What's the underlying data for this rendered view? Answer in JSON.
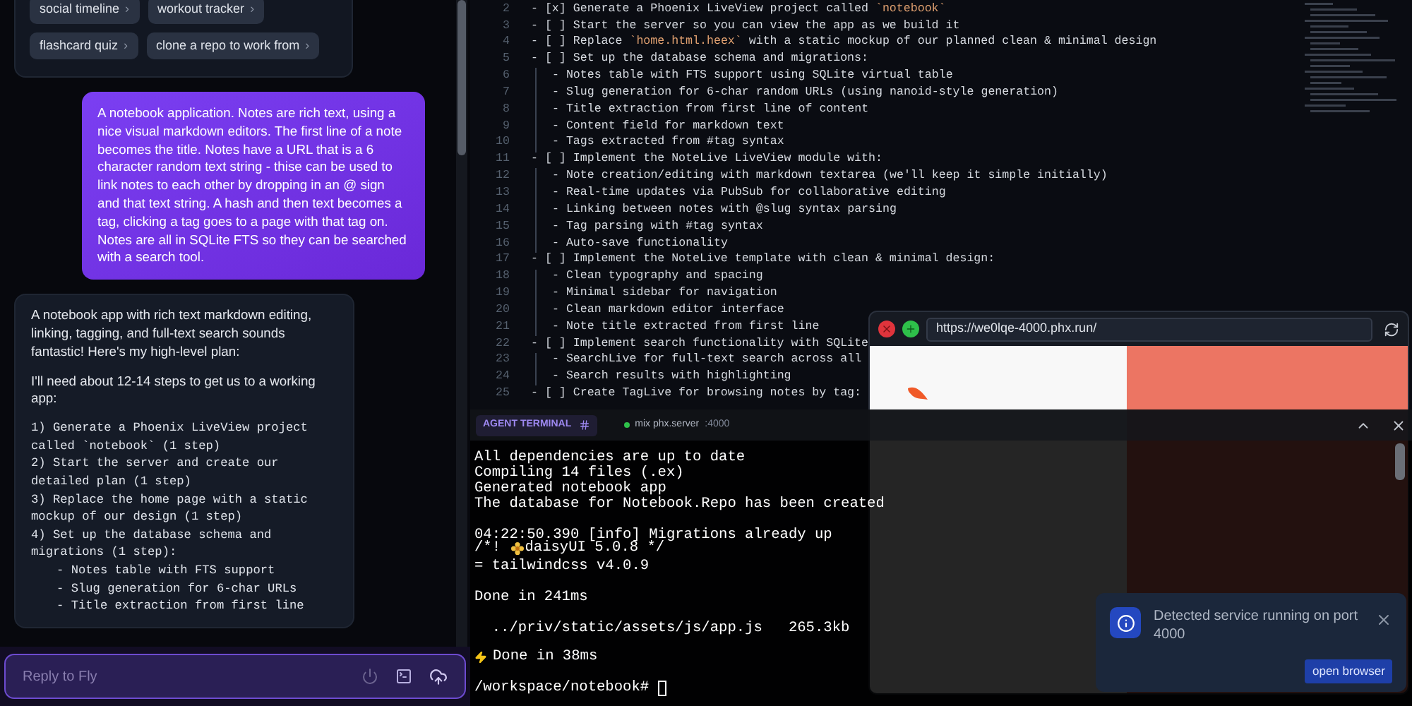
{
  "chat": {
    "suggestions": [
      {
        "label": "social timeline",
        "arrow": "›"
      },
      {
        "label": "workout tracker",
        "arrow": "›"
      },
      {
        "label": "flashcard quiz",
        "arrow": "›"
      },
      {
        "label": "clone a repo to work from",
        "arrow": "›"
      }
    ],
    "user_message": "A notebook application. Notes are rich text, using a nice visual markdown editors. The first line of a note becomes the title. Notes have a URL that is a 6 character random text string - thise can be used to link notes to each other by dropping in an @ sign and that text string. A hash and then text becomes a tag, clicking a tag goes to a page with that tag on. Notes are all in SQLite FTS so they can be searched with a search tool.",
    "assistant_message": {
      "paragraphs": [
        "A notebook app with rich text markdown editing, linking, tagging, and full-text search sounds fantastic! Here's my high-level plan:",
        "I'll need about 12-14 steps to get us to a working app:"
      ],
      "plan": [
        {
          "text": "1) Generate a Phoenix LiveView project called `notebook` (1 step)"
        },
        {
          "text": "2) Start the server and create our detailed plan (1 step)"
        },
        {
          "text": "3) Replace the home page with a static mockup of our design (1 step)"
        },
        {
          "text": "4) Set up the database schema and migrations (1 step):",
          "children": [
            {
              "text": "- Notes table with FTS support"
            },
            {
              "text": "- Slug generation for 6-char URLs"
            },
            {
              "text": "- Title extraction from first line"
            }
          ]
        }
      ]
    },
    "input": {
      "placeholder": "Reply to Fly"
    }
  },
  "editor": {
    "lines": [
      {
        "number": "2",
        "parts": [
          {
            "kind": "plain",
            "text": "- [x] Generate a Phoenix LiveView project called "
          },
          {
            "kind": "code",
            "text": "`notebook`"
          }
        ]
      },
      {
        "number": "3",
        "parts": [
          {
            "kind": "plain",
            "text": "- [ ] Start the server so you can view the app as we build it"
          }
        ]
      },
      {
        "number": "4",
        "parts": [
          {
            "kind": "plain",
            "text": "- [ ] Replace "
          },
          {
            "kind": "code",
            "text": "`home.html.heex`"
          },
          {
            "kind": "plain",
            "text": " with a static mockup of our planned clean & minimal design"
          }
        ]
      },
      {
        "number": "5",
        "parts": [
          {
            "kind": "plain",
            "text": "- [ ] Set up the database schema and migrations:"
          }
        ],
        "children": [
          {
            "number": "6",
            "parts": [
              {
                "kind": "plain",
                "text": "- Notes table with FTS support using SQLite virtual table"
              }
            ]
          },
          {
            "number": "7",
            "parts": [
              {
                "kind": "plain",
                "text": "- Slug generation for 6-char random URLs (using nanoid-style generation)"
              }
            ]
          },
          {
            "number": "8",
            "parts": [
              {
                "kind": "plain",
                "text": "- Title extraction from first line of content"
              }
            ]
          },
          {
            "number": "9",
            "parts": [
              {
                "kind": "plain",
                "text": "- Content field for markdown text"
              }
            ]
          },
          {
            "number": "10",
            "parts": [
              {
                "kind": "plain",
                "text": "- Tags extracted from #tag syntax"
              }
            ]
          }
        ]
      },
      {
        "number": "11",
        "parts": [
          {
            "kind": "plain",
            "text": "- [ ] Implement the NoteLive LiveView module with:"
          }
        ],
        "children": [
          {
            "number": "12",
            "parts": [
              {
                "kind": "plain",
                "text": "- Note creation/editing with markdown textarea (we'll keep it simple initially)"
              }
            ]
          },
          {
            "number": "13",
            "parts": [
              {
                "kind": "plain",
                "text": "- Real-time updates via PubSub for collaborative editing"
              }
            ]
          },
          {
            "number": "14",
            "parts": [
              {
                "kind": "plain",
                "text": "- Linking between notes with @slug syntax parsing"
              }
            ]
          },
          {
            "number": "15",
            "parts": [
              {
                "kind": "plain",
                "text": "- Tag parsing with #tag syntax"
              }
            ]
          },
          {
            "number": "16",
            "parts": [
              {
                "kind": "plain",
                "text": "- Auto-save functionality"
              }
            ]
          }
        ]
      },
      {
        "number": "17",
        "parts": [
          {
            "kind": "plain",
            "text": "- [ ] Implement the NoteLive template with clean & minimal design:"
          }
        ],
        "children": [
          {
            "number": "18",
            "parts": [
              {
                "kind": "plain",
                "text": "- Clean typography and spacing"
              }
            ]
          },
          {
            "number": "19",
            "parts": [
              {
                "kind": "plain",
                "text": "- Minimal sidebar for navigation"
              }
            ]
          },
          {
            "number": "20",
            "parts": [
              {
                "kind": "plain",
                "text": "- Clean markdown editor interface"
              }
            ]
          },
          {
            "number": "21",
            "parts": [
              {
                "kind": "plain",
                "text": "- Note title extracted from first line"
              }
            ]
          }
        ]
      },
      {
        "number": "22",
        "parts": [
          {
            "kind": "plain",
            "text": "- [ ] Implement search functionality with SQLite"
          }
        ],
        "children": [
          {
            "number": "23",
            "parts": [
              {
                "kind": "plain",
                "text": "- SearchLive for full-text search across all"
              }
            ]
          },
          {
            "number": "24",
            "parts": [
              {
                "kind": "plain",
                "text": "- Search results with highlighting"
              }
            ]
          }
        ]
      },
      {
        "number": "25",
        "parts": [
          {
            "kind": "plain",
            "text": "- [ ] Create TagLive for browsing notes by tag:"
          }
        ]
      }
    ]
  },
  "browser": {
    "url": "https://we0lqe-4000.phx.run/"
  },
  "terminal": {
    "tabs": [
      {
        "kind": "agent",
        "label": "AGENT TERMINAL",
        "selected": true
      },
      {
        "kind": "process",
        "label": "mix phx.server",
        "port": ":4000",
        "selected": false
      }
    ],
    "lines": [
      {
        "kind": "text",
        "text": "All dependencies are up to date"
      },
      {
        "kind": "text",
        "text": "Compiling 14 files (.ex)"
      },
      {
        "kind": "text",
        "text": "Generated notebook app"
      },
      {
        "kind": "text",
        "text": "The database for Notebook.Repo has been created"
      },
      {
        "kind": "blank"
      },
      {
        "kind": "text",
        "text": "04:22:50.390 [info] Migrations already up"
      },
      {
        "kind": "flower",
        "before": "/*! ",
        "text": "daisyUI 5.0.8 */"
      },
      {
        "kind": "text",
        "text": "= tailwindcss v4.0.9"
      },
      {
        "kind": "blank"
      },
      {
        "kind": "text",
        "text": "Done in 241ms"
      },
      {
        "kind": "blank"
      },
      {
        "kind": "text",
        "text": "  ../priv/static/assets/js/app.js   265.3kb"
      },
      {
        "kind": "blank"
      },
      {
        "kind": "bolt",
        "text": "Done in 38ms"
      },
      {
        "kind": "blank"
      },
      {
        "kind": "prompt",
        "text": "/workspace/notebook#"
      }
    ]
  },
  "notification": {
    "message": "Detected service running on port 4000",
    "action": "open browser"
  }
}
